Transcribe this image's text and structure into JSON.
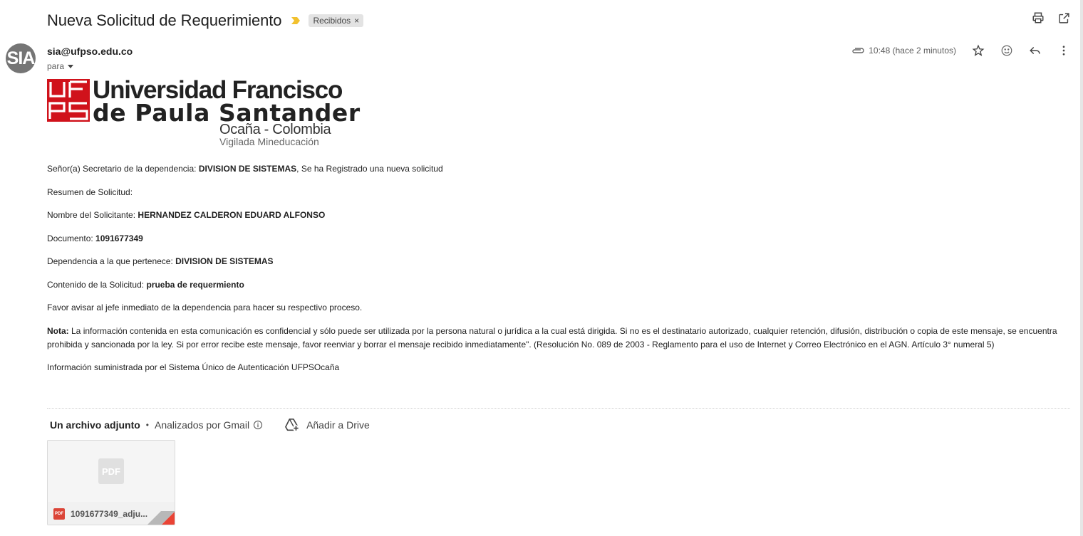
{
  "header": {
    "subject": "Nueva Solicitud de Requerimiento",
    "label": "Recibidos",
    "label_close": "×",
    "icons": [
      "print-icon",
      "open-in-new-window-icon"
    ]
  },
  "sender": {
    "avatar_text": "SIA",
    "email": "sia@ufpso.edu.co",
    "recipient_label": "para",
    "time": "10:48 (hace 2 minutos)",
    "icons": [
      "attachment-clip-icon",
      "star-icon",
      "emoji-reaction-icon",
      "reply-icon",
      "more-vert-icon"
    ]
  },
  "logo": {
    "mark_letters": "UFPS",
    "line1": "Universidad Francisco",
    "line2": "de Paula Santander",
    "line3": "Ocaña - Colombia",
    "line4": "Vigilada Mineducación",
    "brand_color": "#d0121b"
  },
  "message": {
    "greeting_prefix": "Señor(a) Secretario de la dependencia: ",
    "greeting_dependency": "DIVISION DE SISTEMAS",
    "greeting_suffix": ", Se ha Registrado una nueva solicitud",
    "summary_title": "Resumen de Solicitud:",
    "applicant_label": "Nombre del Solicitante: ",
    "applicant_value": "HERNANDEZ CALDERON EDUARD ALFONSO",
    "document_label": "Documento: ",
    "document_value": "1091677349",
    "dependency_label": "Dependencia a la que pertenece: ",
    "dependency_value": "DIVISION DE SISTEMAS",
    "content_label": "Contenido de la Solicitud: ",
    "content_value": "prueba de requermiento",
    "instruction": "Favor avisar al jefe inmediato de la dependencia para hacer su respectivo proceso.",
    "note_label": "Nota:",
    "note_text": " La información contenida en esta comunicación es confidencial y sólo puede ser utilizada por la persona natural o jurídica a la cual está dirigida. Si no es el destinatario autorizado, cualquier retención, difusión, distribución o copia de este mensaje, se encuentra prohibida y sancionada por la ley. Si por error recibe este mensaje, favor reenviar y borrar el mensaje recibido inmediatamente\". (Resolución No. 089 de 2003 - Reglamento para el uso de Internet y Correo Electrónico en el AGN. Artículo 3° numeral 5)",
    "footer": "Información suministrada por el Sistema Único de Autenticación UFPSOcaña"
  },
  "attachments": {
    "count_label": "Un archivo adjunto",
    "separator": "•",
    "scan_label": "Analizados por Gmail",
    "drive_label": "Añadir a Drive",
    "files": [
      {
        "thumb_text": "PDF",
        "badge": "PDF",
        "name": "1091677349_adju..."
      }
    ]
  }
}
